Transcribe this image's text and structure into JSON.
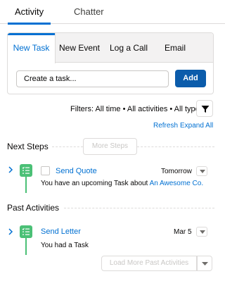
{
  "top_tabs": [
    {
      "label": "Activity",
      "active": true
    },
    {
      "label": "Chatter",
      "active": false
    }
  ],
  "composer": {
    "tabs": [
      {
        "label": "New Task",
        "active": true
      },
      {
        "label": "New Event"
      },
      {
        "label": "Log a Call"
      },
      {
        "label": "Email"
      }
    ],
    "input_value": "Create a task...",
    "add_label": "Add"
  },
  "filters": {
    "text": "Filters: All time • All activities • All types",
    "refresh_label": "Refresh",
    "expand_label": "Expand All"
  },
  "next_steps": {
    "title": "Next Steps",
    "more_label": "More Steps",
    "items": [
      {
        "title": "Send Quote",
        "date": "Tomorrow",
        "desc_prefix": "You have an upcoming Task about ",
        "desc_link": "An Awesome Co."
      }
    ]
  },
  "past_activities": {
    "title": "Past Activities",
    "load_more_label": "Load More Past Activities",
    "items": [
      {
        "title": "Send Letter",
        "date": "Mar 5",
        "desc": "You had a Task"
      }
    ]
  },
  "colors": {
    "brand": "#0070d2",
    "button": "#0b5cab",
    "task_icon": "#4bc076"
  },
  "icons": [
    "filter-icon",
    "chevron-right-icon",
    "task-icon",
    "chevron-down-icon"
  ]
}
